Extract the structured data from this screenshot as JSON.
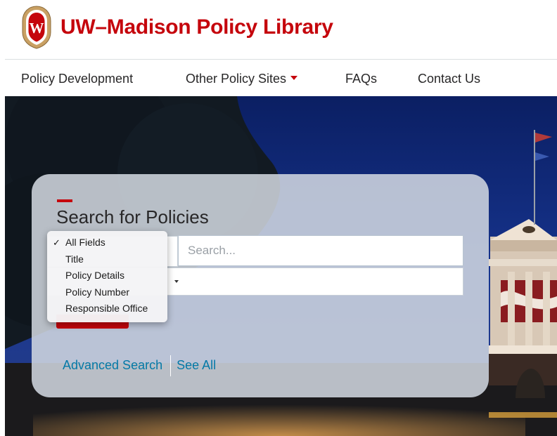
{
  "header": {
    "title": "UW–Madison Policy Library",
    "logo_letter": "W"
  },
  "nav": {
    "items": [
      {
        "label": "Policy Development"
      },
      {
        "label": "Other Policy Sites",
        "has_dropdown": true
      },
      {
        "label": "FAQs"
      },
      {
        "label": "Contact Us"
      }
    ]
  },
  "search": {
    "title": "Search for Policies",
    "placeholder": "Search...",
    "field_options": [
      "All Fields",
      "Title",
      "Policy Details",
      "Policy Number",
      "Responsible Office"
    ],
    "selected_option": "All Fields",
    "advanced_search_label": "Advanced Search",
    "see_all_label": "See All"
  },
  "colors": {
    "brand_red": "#c5050c",
    "link_blue": "#0479a8",
    "nav_text": "#282728"
  },
  "icons": {
    "logo": "uw-crest-icon",
    "nav_dropdown": "caret-down-icon",
    "selected_option": "checkmark-icon"
  }
}
